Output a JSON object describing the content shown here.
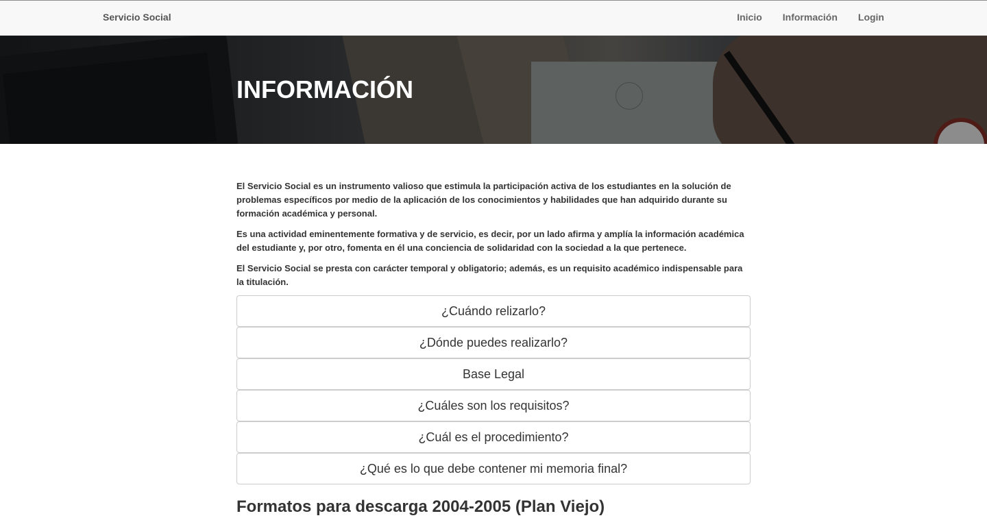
{
  "navbar": {
    "brand": "Servicio Social",
    "links": [
      {
        "label": "Inicio"
      },
      {
        "label": "Información"
      },
      {
        "label": "Login"
      }
    ]
  },
  "hero": {
    "title": "INFORMACIÓN"
  },
  "intro": {
    "paragraphs": [
      "El Servicio Social es un instrumento valioso que estimula la participación activa de los estudiantes en la solución de problemas específicos por medio de la aplicación de los conocimientos y habilidades que han adquirido durante su formación académica y personal.",
      "Es una actividad eminentemente formativa y de servicio, es decir, por un lado afirma y amplía la información académica del estudiante y, por otro, fomenta en él una conciencia de solidaridad con la sociedad a la que pertenece.",
      "El Servicio Social se presta con carácter temporal y obligatorio; además, es un requisito académico indispensable para la titulación."
    ]
  },
  "accordion": {
    "items": [
      {
        "label": "¿Cuándo relizarlo?"
      },
      {
        "label": "¿Dónde puedes realizarlo?"
      },
      {
        "label": "Base Legal"
      },
      {
        "label": "¿Cuáles son los requisitos?"
      },
      {
        "label": "¿Cuál es el procedimiento?"
      },
      {
        "label": "¿Qué es lo que debe contener mi memoria final?"
      }
    ]
  },
  "downloads": {
    "title": "Formatos para descarga 2004-2005 (Plan Viejo)"
  }
}
